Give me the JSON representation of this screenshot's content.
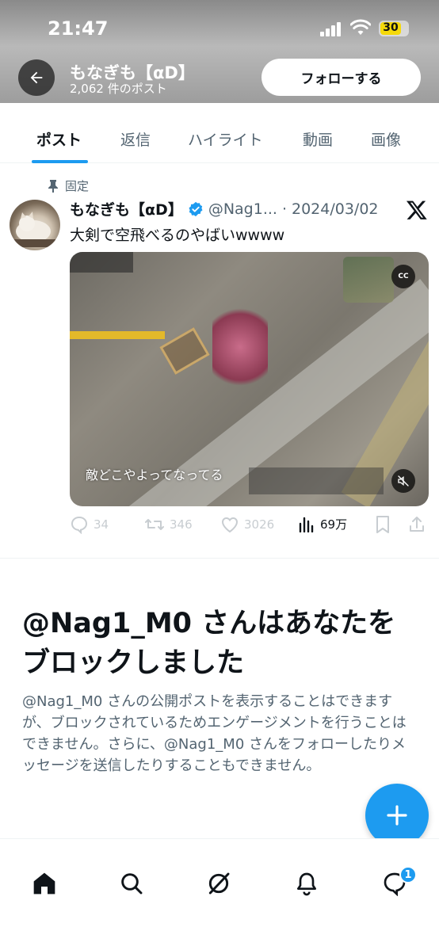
{
  "status_bar": {
    "time": "21:47",
    "battery": "30"
  },
  "header": {
    "profile_name": "もなぎも【αD】",
    "post_count": "2,062 件のポスト",
    "follow_label": "フォローする"
  },
  "tabs": [
    {
      "label": "ポスト",
      "active": true
    },
    {
      "label": "返信"
    },
    {
      "label": "ハイライト"
    },
    {
      "label": "動画"
    },
    {
      "label": "画像"
    }
  ],
  "post": {
    "pinned_label": "固定",
    "author": "もなぎも【αD】",
    "handle": "@Nag1...",
    "separator": "·",
    "date": "2024/03/02",
    "text": "大剣で空飛べるのやばいwwww",
    "video": {
      "cc_label": "CC",
      "subtitle": "敵どこやよってなってる"
    },
    "stats": {
      "replies": "34",
      "reposts": "346",
      "likes": "3026",
      "views": "69万"
    }
  },
  "blocked": {
    "title": "@Nag1_M0 さんはあなたをブロックしました",
    "description": "@Nag1_M0 さんの公開ポストを表示することはできますが、ブロックされているためエンゲージメントを行うことはできません。さらに、@Nag1_M0 さんをフォローしたりメッセージを送信したりすることもできません。"
  },
  "nav": {
    "items": [
      "home-icon",
      "search-icon",
      "grok-icon",
      "notifications-icon",
      "messages-icon"
    ],
    "messages_badge": "1"
  },
  "colors": {
    "accent": "#1d9bf0",
    "text": "#0f1419",
    "secondary": "#536471"
  }
}
